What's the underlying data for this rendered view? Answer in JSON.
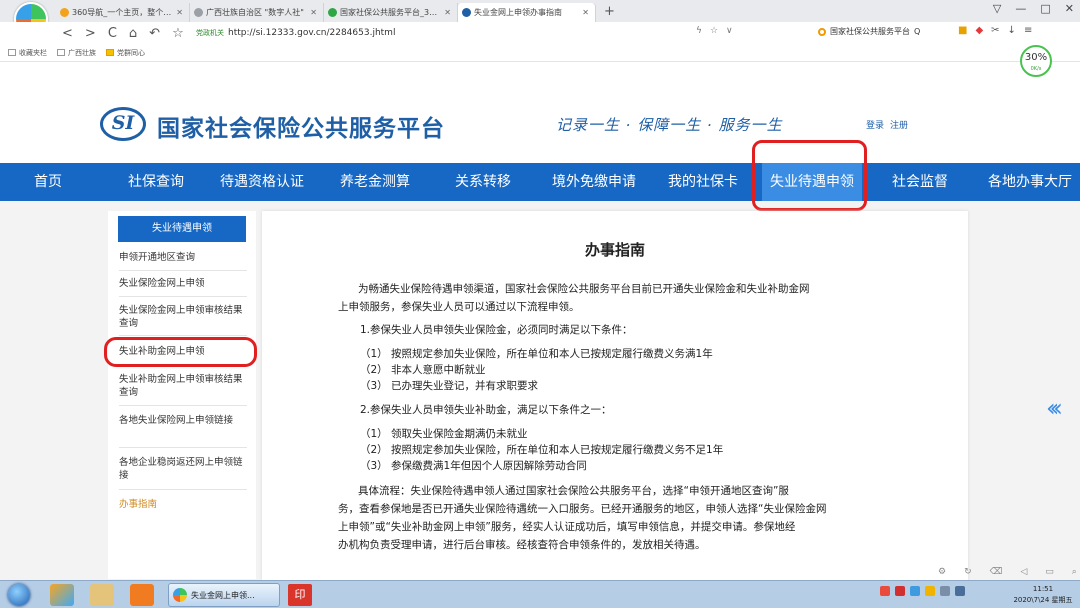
{
  "browser": {
    "tabs": [
      {
        "label": "360导航_一个主页，整个世界",
        "active": false,
        "icon_color": "#f3a21b"
      },
      {
        "label": "广西壮族自治区 \"数字人社\"",
        "active": false,
        "icon_color": "#9aa0a6"
      },
      {
        "label": "国家社保公共服务平台_360搜",
        "active": false,
        "icon_color": "#2ea844"
      },
      {
        "label": "失业金网上申领办事指南",
        "active": true,
        "icon_color": "#1f5fa6"
      }
    ],
    "new_tab": "+",
    "window_controls": [
      "▽",
      "—",
      "□",
      "✕"
    ],
    "nav_buttons": [
      "<",
      ">",
      "C",
      "⌂",
      "↶",
      "☆"
    ],
    "secure_label": "党政机关",
    "url": "http://si.12333.gov.cn/2284653.jhtml",
    "search_engine_text": "国家社保公共服务平台",
    "bookmarks": [
      "收藏夹栏",
      "广西壮族",
      "党群同心"
    ],
    "speed": {
      "percent": "30%",
      "rate": "0K/s"
    }
  },
  "site": {
    "logo_text": "SI",
    "title": "国家社会保险公共服务平台",
    "slogan": "记录一生 · 保障一生 · 服务一生",
    "login": "登录",
    "register": "注册"
  },
  "nav": {
    "items": [
      {
        "label": "首页",
        "active": false
      },
      {
        "label": "社保查询",
        "active": false
      },
      {
        "label": "待遇资格认证",
        "active": false
      },
      {
        "label": "养老金测算",
        "active": false
      },
      {
        "label": "关系转移",
        "active": false
      },
      {
        "label": "境外免缴申请",
        "active": false
      },
      {
        "label": "我的社保卡",
        "active": false
      },
      {
        "label": "失业待遇申领",
        "active": true
      },
      {
        "label": "社会监督",
        "active": false
      },
      {
        "label": "各地办事大厅",
        "active": false
      }
    ]
  },
  "sidebar": {
    "heading": "失业待遇申领",
    "items": [
      {
        "label": "申领开通地区查询"
      },
      {
        "label": "失业保险金网上申领"
      },
      {
        "label": "失业保险金网上申领审核结果查询"
      },
      {
        "label": "失业补助金网上申领"
      },
      {
        "label": "失业补助金网上申领审核结果查询"
      },
      {
        "label": "各地失业保险网上申领链接"
      },
      {
        "label": "各地企业稳岗返还网上申领链接"
      },
      {
        "label": "办事指南"
      }
    ]
  },
  "content": {
    "title": "办事指南",
    "lines": [
      "为畅通失业保险待遇申领渠道，国家社会保险公共服务平台目前已开通失业保险金和失业补助金网",
      "上申领服务，参保失业人员可以通过以下流程申领。",
      "1.参保失业人员申领失业保险金，必须同时满足以下条件：",
      "（1） 按照规定参加失业保险，所在单位和本人已按规定履行缴费义务满1年",
      "（2） 非本人意愿中断就业",
      "（3） 已办理失业登记，并有求职要求",
      "2.参保失业人员申领失业补助金，满足以下条件之一：",
      "（1） 领取失业保险金期满仍未就业",
      "（2） 按照规定参加失业保险，所在单位和本人已按规定履行缴费义务不足1年",
      "（3） 参保缴费满1年但因个人原因解除劳动合同",
      "具体流程：失业保险待遇申领人通过国家社会保险公共服务平台，选择“申领开通地区查询”服",
      "务，查看参保地是否已开通失业保险待遇统一入口服务。已经开通服务的地区，申领人选择“失业保险金网",
      "上申领”或“失业补助金网上申领”服务，经实人认证成功后，填写申领信息，并提交申请。参保地经",
      "办机构负责受理申请，进行后台审核。经核查符合申领条件的，发放相关待遇。"
    ]
  },
  "taskbar": {
    "browser_task_label": "失业金网上申领...",
    "red_app_label": "印",
    "clock_time": "11:51",
    "clock_date": "2020\\7\\24 星期五"
  },
  "colors": {
    "brand_blue": "#1668c4",
    "active_nav": "#3a8de3",
    "highlight_red": "#e02020",
    "current_side_item": "#d08a20"
  }
}
